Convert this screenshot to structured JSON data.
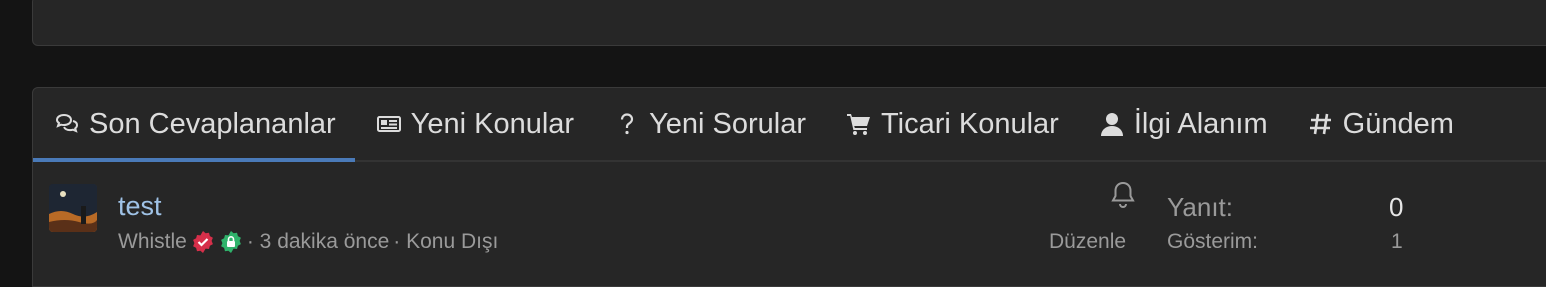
{
  "tabs": [
    {
      "label": "Son Cevaplananlar",
      "icon": "comments-icon",
      "active": true
    },
    {
      "label": "Yeni Konular",
      "icon": "newspaper-icon",
      "active": false
    },
    {
      "label": "Yeni Sorular",
      "icon": "question-icon",
      "active": false
    },
    {
      "label": "Ticari Konular",
      "icon": "cart-icon",
      "active": false
    },
    {
      "label": "İlgi Alanım",
      "icon": "user-icon",
      "active": false
    },
    {
      "label": "Gündem",
      "icon": "hashtag-icon",
      "active": false
    }
  ],
  "thread": {
    "title": "test",
    "author": "Whistle",
    "time": "· 3 dakika önce",
    "forum": "· Konu Dışı",
    "edit_label": "Düzenle",
    "replies_label": "Yanıt:",
    "replies_value": "0",
    "views_label": "Gösterim:",
    "views_value": "1"
  },
  "colors": {
    "accent": "#4a7ab8",
    "link": "#9fc2e6",
    "verified_badge": "#d62f4a",
    "secure_badge": "#2fb36b"
  }
}
